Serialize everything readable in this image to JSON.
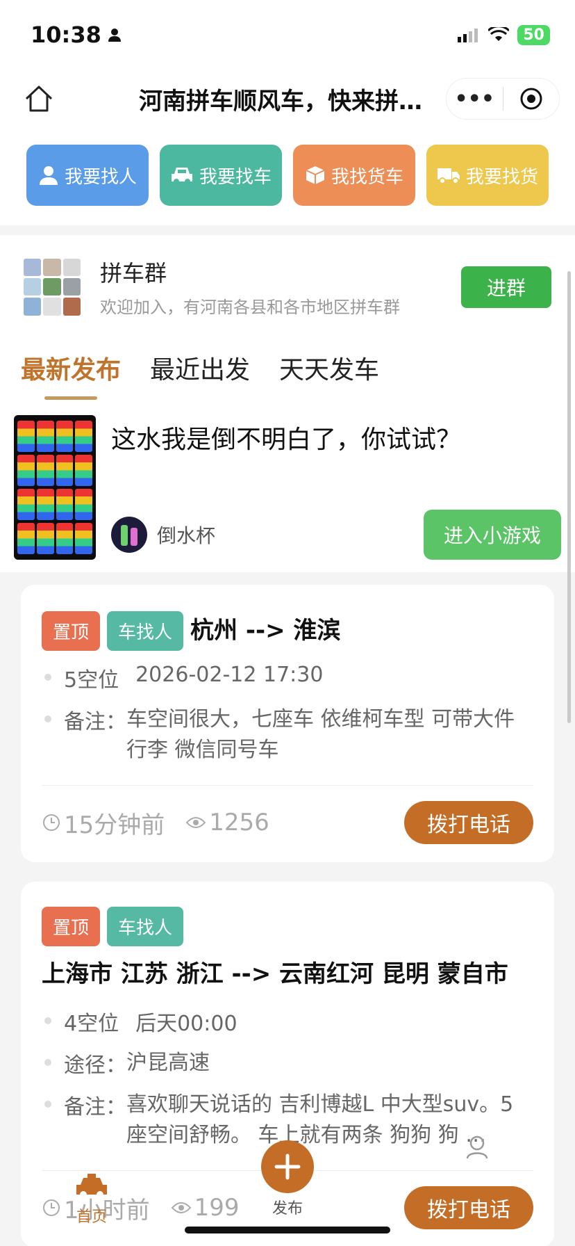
{
  "status": {
    "time": "10:38",
    "battery": "50"
  },
  "nav": {
    "title": "河南拼车顺风车，快来拼…"
  },
  "quick_actions": [
    {
      "label": "我要找人",
      "color": "#5b9ce8"
    },
    {
      "label": "我要找车",
      "color": "#4db8a0"
    },
    {
      "label": "我找货车",
      "color": "#ec8e55"
    },
    {
      "label": "我要找货",
      "color": "#eec74d"
    }
  ],
  "group": {
    "name": "拼车群",
    "desc": "欢迎加入，有河南各县和各市地区拼车群",
    "join_label": "进群"
  },
  "tabs": [
    "最新发布",
    "最近出发",
    "天天发车"
  ],
  "ad": {
    "title": "这水我是倒不明白了，你试试？",
    "user": "倒水杯",
    "button": "进入小游戏"
  },
  "posts": [
    {
      "tag_top": "置顶",
      "tag_kind": "车找人",
      "route": "杭州 --> 淮滨",
      "seats": "5空位",
      "time": "2026-02-12 17:30",
      "note_label": "备注：",
      "note": "车空间很大，七座车 依维柯车型 可带大件行李 微信同号车",
      "ago": "15分钟前",
      "views": "1256",
      "call": "拨打电话"
    },
    {
      "tag_top": "置顶",
      "tag_kind": "车找人",
      "route": "上海市 江苏 浙江 --> 云南红河 昆明 蒙自市",
      "seats": "4空位",
      "time": "后天00:00",
      "via_label": "途径：",
      "via": "沪昆高速",
      "note_label": "备注：",
      "note": "喜欢聊天说话的 吉利博越L  中大型suv。5座空间舒畅。 车上就有两条 狗狗 狗 …",
      "ago": "1小时前",
      "views": "199",
      "call": "拨打电话"
    }
  ],
  "tabbar": {
    "home": "首页",
    "publish": "发布"
  }
}
